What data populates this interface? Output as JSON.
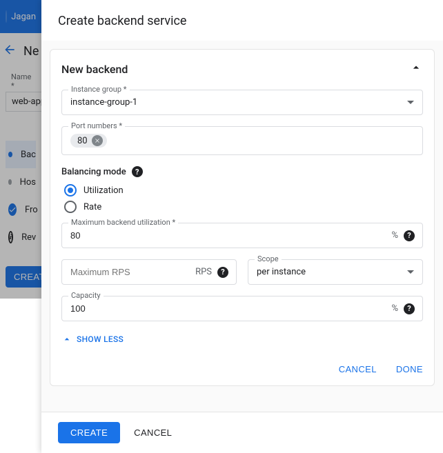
{
  "bg": {
    "user": "Jagan",
    "page_heading": "Ne",
    "name_label": "Name  *",
    "name_value": "web-app-",
    "steps": {
      "backend": "Bac",
      "host": "Hos",
      "frontend": "Fro",
      "review": "Rev"
    },
    "create": "Create"
  },
  "panel": {
    "title": "Create backend service",
    "card_title": "New backend",
    "instance_group": {
      "label": "Instance group *",
      "value": "instance-group-1"
    },
    "port_numbers": {
      "label": "Port numbers *",
      "chip": "80"
    },
    "balancing_mode": {
      "label": "Balancing mode",
      "utilization": "Utilization",
      "rate": "Rate"
    },
    "max_util": {
      "label": "Maximum backend utilization *",
      "value": "80",
      "unit": "%"
    },
    "max_rps": {
      "placeholder": "Maximum RPS",
      "unit": "RPS"
    },
    "scope": {
      "label": "Scope",
      "value": "per instance"
    },
    "capacity": {
      "label": "Capacity",
      "value": "100",
      "unit": "%"
    },
    "show_less": "Show less",
    "sub_cancel": "Cancel",
    "sub_done": "Done",
    "footer_create": "Create",
    "footer_cancel": "Cancel"
  }
}
